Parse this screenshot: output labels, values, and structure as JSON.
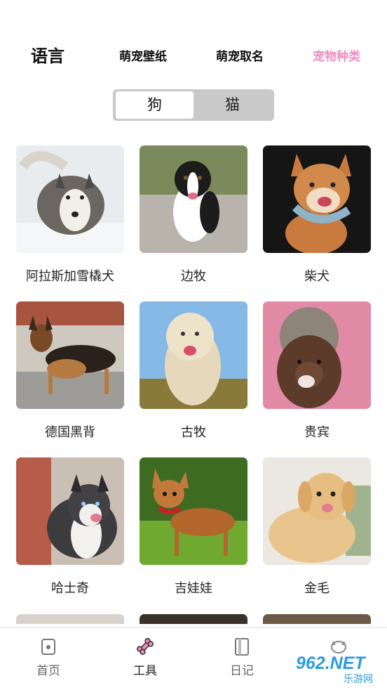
{
  "header": {
    "tabs": [
      {
        "label": "语言",
        "active": true
      },
      {
        "label": "萌宠壁纸"
      },
      {
        "label": "萌宠取名"
      },
      {
        "label": "宠物种类",
        "color": "#f08dc1"
      }
    ]
  },
  "segment": {
    "options": [
      "狗",
      "猫"
    ],
    "selected": "狗"
  },
  "breeds": [
    {
      "name": "阿拉斯加雪橇犬"
    },
    {
      "name": "边牧"
    },
    {
      "name": "柴犬"
    },
    {
      "name": "德国黑背"
    },
    {
      "name": "古牧"
    },
    {
      "name": "贵宾"
    },
    {
      "name": "哈士奇"
    },
    {
      "name": "吉娃娃"
    },
    {
      "name": "金毛"
    }
  ],
  "bottom_nav": {
    "items": [
      {
        "label": "首页",
        "icon": "home-icon"
      },
      {
        "label": "工具",
        "icon": "bone-icon",
        "active": true
      },
      {
        "label": "日记",
        "icon": "notebook-icon"
      },
      {
        "label": "",
        "icon": "cat-profile-icon"
      }
    ]
  },
  "watermark": {
    "text": "962.NET",
    "sub": "乐游网"
  },
  "colors": {
    "accent_pink": "#f08dc1",
    "segment_bg": "#c9c9c9"
  }
}
